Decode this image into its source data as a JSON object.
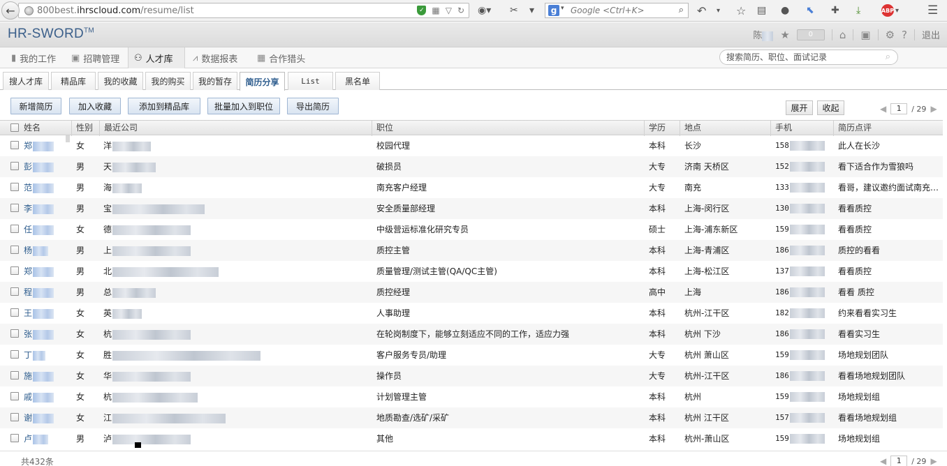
{
  "browser": {
    "url_prefix": "800best.",
    "url_host": "ihrscloud.com",
    "url_path": "/resume/list",
    "search_placeholder": "Google <Ctrl+K>",
    "adblock_label": "ABP"
  },
  "header": {
    "brand": "HR-SWORD",
    "brand_tm": "TM",
    "user_initial": "陈",
    "star_count": "0",
    "help": "?",
    "logout": "退出"
  },
  "main_nav": {
    "tabs": [
      {
        "label": "我的工作",
        "icon": "briefcase-icon"
      },
      {
        "label": "招聘管理",
        "icon": "id-card-icon"
      },
      {
        "label": "人才库",
        "icon": "users-icon",
        "active": true
      },
      {
        "label": "数据报表",
        "icon": "chart-icon"
      },
      {
        "label": "合作猎头",
        "icon": "grid-icon"
      }
    ],
    "search_placeholder": "搜索简历、职位、面试记录"
  },
  "sub_tabs": [
    {
      "label": "搜人才库"
    },
    {
      "label": "精品库"
    },
    {
      "label": "我的收藏"
    },
    {
      "label": "我的购买"
    },
    {
      "label": "我的暂存"
    },
    {
      "label": "简历分享",
      "active": true
    },
    {
      "label": "List"
    },
    {
      "label": "黑名单"
    }
  ],
  "toolbar": {
    "buttons": [
      "新增简历",
      "加入收藏",
      "添加到精品库",
      "批量加入到职位",
      "导出简历"
    ],
    "expand": "展开",
    "collapse": "收起",
    "page_current": "1",
    "page_total": "/ 29"
  },
  "grid": {
    "columns": [
      "姓名",
      "性别",
      "最近公司",
      "职位",
      "学历",
      "地点",
      "手机",
      "简历点评"
    ],
    "rows": [
      {
        "name": "郑",
        "gender": "女",
        "company": "洋",
        "position": "校园代理",
        "edu": "本科",
        "location": "长沙",
        "phone": "158",
        "comment": "此人在长沙"
      },
      {
        "name": "彭",
        "gender": "男",
        "company": "天",
        "position": "破损员",
        "edu": "大专",
        "location": "济南 天桥区",
        "phone": "152",
        "comment": "看下适合作为雪狼吗"
      },
      {
        "name": "范",
        "gender": "男",
        "company": "海",
        "position": "南充客户经理",
        "edu": "大专",
        "location": "南充",
        "phone": "133",
        "comment": "看哥，建议邀约面试南充…"
      },
      {
        "name": "李",
        "gender": "男",
        "company": "宝",
        "position": "安全质量部经理",
        "edu": "本科",
        "location": "上海-闵行区",
        "phone": "130",
        "comment": "看看质控"
      },
      {
        "name": "任",
        "gender": "女",
        "company": "德",
        "position": "中级营运标准化研究专员",
        "edu": "硕士",
        "location": "上海-浦东新区",
        "phone": "159",
        "comment": "看看质控"
      },
      {
        "name": "杨",
        "gender": "男",
        "company": "上",
        "position": "质控主管",
        "edu": "本科",
        "location": "上海-青浦区",
        "phone": "186",
        "comment": "质控的看看"
      },
      {
        "name": "郑",
        "gender": "男",
        "company": "北",
        "position": "质量管理/测试主管(QA/QC主管)",
        "edu": "本科",
        "location": "上海-松江区",
        "phone": "137",
        "comment": "看看质控"
      },
      {
        "name": "程",
        "gender": "男",
        "company": "总",
        "position": "质控经理",
        "edu": "高中",
        "location": "上海",
        "phone": "186",
        "comment": "看看 质控"
      },
      {
        "name": "王",
        "gender": "女",
        "company": "英",
        "position": "人事助理",
        "edu": "本科",
        "location": "杭州-江干区",
        "phone": "182",
        "comment": "约来看看实习生"
      },
      {
        "name": "张",
        "gender": "女",
        "company": "杭",
        "position": "在轮岗制度下，能够立刻适应不同的工作，适应力强",
        "edu": "本科",
        "location": "杭州 下沙",
        "phone": "186",
        "comment": "看看实习生"
      },
      {
        "name": "丁",
        "gender": "女",
        "company": "胜",
        "position": "客户服务专员/助理",
        "edu": "大专",
        "location": "杭州 萧山区",
        "phone": "159",
        "comment": "场地规划团队"
      },
      {
        "name": "施",
        "gender": "女",
        "company": "华",
        "position": "操作员",
        "edu": "大专",
        "location": "杭州-江干区",
        "phone": "186",
        "comment": "看看场地规划团队"
      },
      {
        "name": "戚",
        "gender": "女",
        "company": "杭",
        "position": "计划管理主管",
        "edu": "本科",
        "location": "杭州",
        "phone": "159",
        "comment": "场地规划组"
      },
      {
        "name": "谢",
        "gender": "女",
        "company": "江",
        "position": "地质勘查/选矿/采矿",
        "edu": "本科",
        "location": "杭州 江干区",
        "phone": "157",
        "comment": "看看场地规划组"
      },
      {
        "name": "卢",
        "gender": "男",
        "company": "泸",
        "position": "其他",
        "edu": "本科",
        "location": "杭州-萧山区",
        "phone": "159",
        "comment": "场地规划组"
      }
    ]
  },
  "footer": {
    "total": "共432条"
  }
}
